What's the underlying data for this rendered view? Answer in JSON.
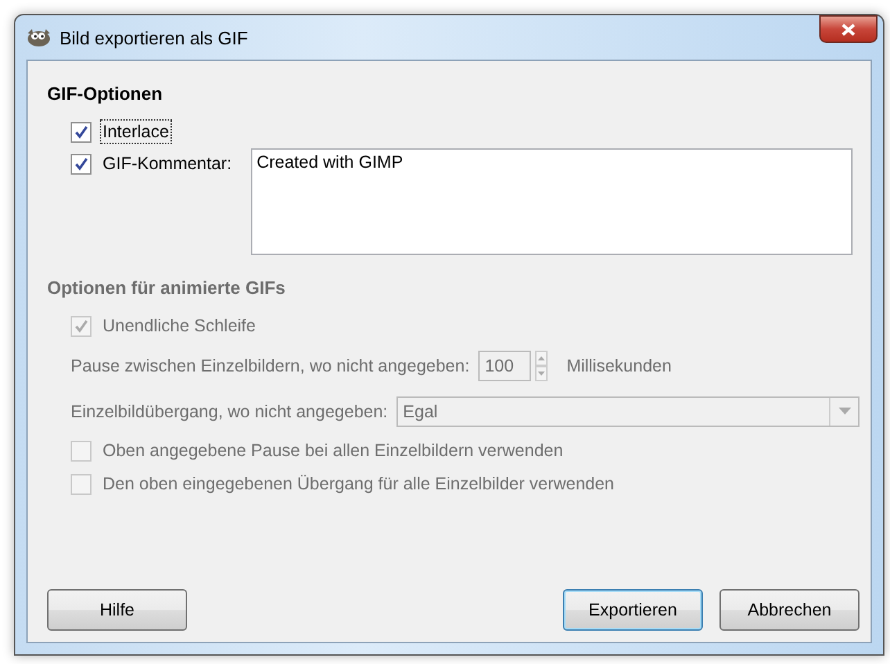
{
  "window": {
    "title": "Bild exportieren als GIF"
  },
  "gif_options": {
    "heading": "GIF-Optionen",
    "interlace": {
      "label": "Interlace",
      "checked": true,
      "focused": true
    },
    "comment": {
      "label": "GIF-Kommentar:",
      "checked": true,
      "value": "Created with GIMP"
    }
  },
  "animation_options": {
    "heading": "Optionen für animierte GIFs",
    "disabled": true,
    "loop": {
      "label": "Unendliche Schleife",
      "checked": true
    },
    "delay": {
      "label": "Pause zwischen Einzelbildern, wo nicht angegeben:",
      "value": "100",
      "unit": "Millisekunden"
    },
    "disposal": {
      "label": "Einzelbildübergang, wo nicht angegeben:",
      "value": "Egal"
    },
    "options": [
      {
        "label": "Oben angegebene Pause bei allen Einzelbildern verwenden",
        "checked": false
      },
      {
        "label": "Den oben eingegebenen Übergang für alle Einzelbilder verwenden",
        "checked": false
      }
    ]
  },
  "buttons": [
    {
      "label": "Hilfe",
      "default": false
    },
    {
      "label": "Exportieren",
      "default": true
    },
    {
      "label": "Abbrechen",
      "default": false
    }
  ]
}
